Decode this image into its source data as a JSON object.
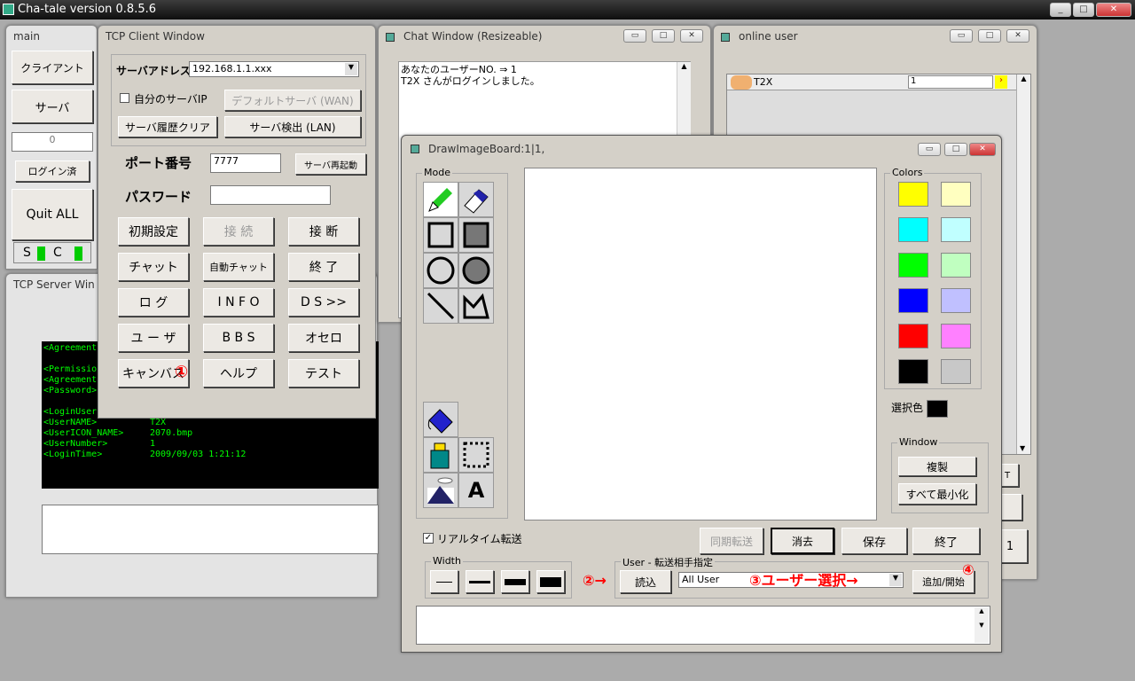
{
  "app": {
    "title": "Cha-tale version 0.8.5.6"
  },
  "main_win": {
    "title": "main",
    "client": "クライアント",
    "server": "サーバ",
    "counter": "0",
    "login": "ログイン済",
    "quit": "Quit ALL",
    "s": "S",
    "c": "C"
  },
  "server_win": {
    "title": "TCP Server Win",
    "lines": [
      "<Agreement",
      "",
      "<Permissio",
      "<Agreement",
      "<Password>",
      "",
      "<LoginUser",
      "<UserNAME>",
      "<UserICON_NAME>",
      "<UserNumber>",
      "<LoginTime>"
    ],
    "values": [
      "",
      "",
      "",
      "",
      "",
      "",
      "",
      "T2X",
      "2070.bmp",
      "1",
      "2009/09/03 1:21:12"
    ]
  },
  "client_win": {
    "title": "TCP Client Window",
    "addr_label": "サーバアドレス",
    "addr_value": "192.168.1.1.xxx",
    "own_server": "自分のサーバIP",
    "default_server": "デフォルトサーバ (WAN)",
    "clear_history": "サーバ履歴クリア",
    "detect": "サーバ検出 (LAN)",
    "port_label": "ポート番号",
    "port_value": "7777",
    "restart": "サーバ再起動",
    "pw_label": "パスワード",
    "btns": [
      "初期設定",
      "接 続",
      "接 断",
      "チャット",
      "自動チャット",
      "終 了",
      "ロ グ",
      "I N F O",
      "D S >>",
      "ユ ー ザ",
      "B B S",
      "オセロ",
      "キャンバス",
      "ヘルプ",
      "テスト"
    ],
    "marker1": "①"
  },
  "chat_win": {
    "title": "Chat Window (Resizeable)",
    "line1": "あなたのユーザーNO. ⇒ 1",
    "line2": "T2X さんがログインしました。"
  },
  "online_win": {
    "title": "online user",
    "user": "T2X",
    "num": "1"
  },
  "draw_win": {
    "title": "DrawImageBoard:1|1,",
    "mode": "Mode",
    "colors": "Colors",
    "selected": "選択色",
    "window": "Window",
    "dup": "複製",
    "minall": "すべて最小化",
    "realtime": "リアルタイム転送",
    "sync": "同期転送",
    "clear": "消去",
    "save": "保存",
    "end": "終了",
    "width": "Width",
    "user_group": "User - 転送相手指定",
    "load": "読込",
    "all_user": "All User",
    "add": "追加/開始",
    "m2": "②→",
    "m3": "③ユーザー選択→",
    "m4": "④"
  },
  "palette": [
    "#ffff00",
    "#ffffc0",
    "#00ffff",
    "#c0ffff",
    "#00ff00",
    "#c0ffc0",
    "#0000ff",
    "#c0c0ff",
    "#ff0000",
    "#ff80ff",
    "#000000",
    "#c8c8c8"
  ]
}
